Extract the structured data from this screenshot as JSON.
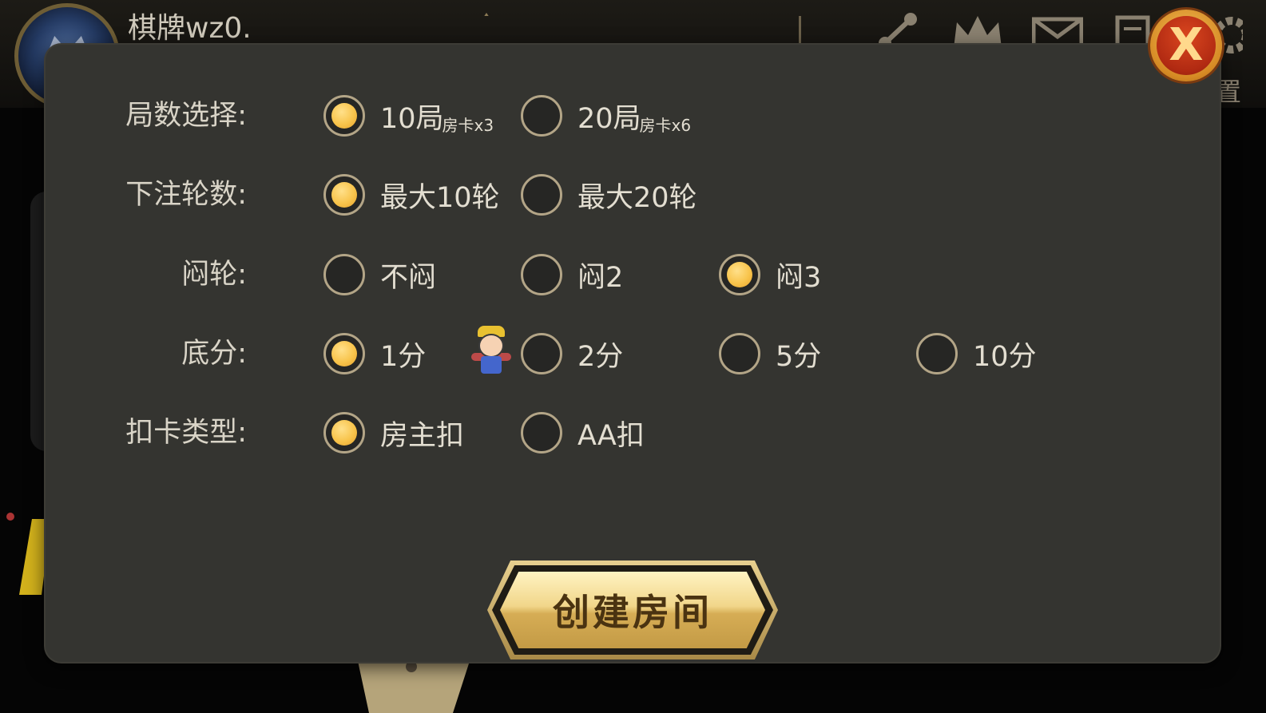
{
  "header": {
    "username": "棋牌wz0.",
    "user_id": "",
    "logo_text": "",
    "icons": [
      "share-icon",
      "crown-icon",
      "mail-icon",
      "document-icon",
      "gear-icon"
    ],
    "settings_label": "置"
  },
  "dialog": {
    "rows": [
      {
        "label": "局数选择:",
        "options": [
          {
            "text": "10局",
            "sub": "房卡x3",
            "selected": true
          },
          {
            "text": "20局",
            "sub": "房卡x6",
            "selected": false
          }
        ]
      },
      {
        "label": "下注轮数:",
        "options": [
          {
            "text": "最大10轮",
            "selected": true
          },
          {
            "text": "最大20轮",
            "selected": false
          }
        ]
      },
      {
        "label": "闷轮:",
        "options": [
          {
            "text": "不闷",
            "selected": false
          },
          {
            "text": "闷2",
            "selected": false
          },
          {
            "text": "闷3",
            "selected": true
          }
        ]
      },
      {
        "label": "底分:",
        "options": [
          {
            "text": "1分",
            "selected": true
          },
          {
            "text": "2分",
            "selected": false
          },
          {
            "text": "5分",
            "selected": false
          },
          {
            "text": "10分",
            "selected": false
          }
        ]
      },
      {
        "label": "扣卡类型:",
        "options": [
          {
            "text": "房主扣",
            "selected": true
          },
          {
            "text": "AA扣",
            "selected": false
          }
        ]
      }
    ],
    "create_button": "创建房间",
    "close_label": "X",
    "watermark": ""
  },
  "colors": {
    "panel": "#343430",
    "radio_border": "#b3a587",
    "radio_selected": "#f8c44c",
    "button_gold": "#f1d68a",
    "close_red": "#b12a12"
  }
}
